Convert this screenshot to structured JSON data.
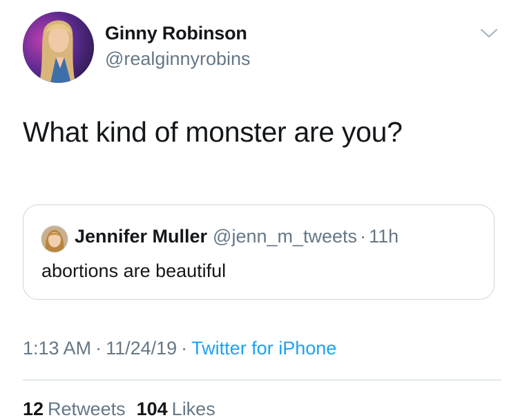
{
  "author": {
    "name": "Ginny Robinson",
    "handle": "@realginnyrobins"
  },
  "tweet": {
    "text": "What kind of monster are you?"
  },
  "quoted_tweet": {
    "name": "Jennifer Muller",
    "handle": "@jenn_m_tweets",
    "dot": "·",
    "time": "11h",
    "text": "abortions are beautiful"
  },
  "meta": {
    "time": "1:13 AM",
    "sep1": "·",
    "date": "11/24/19",
    "sep2": "·",
    "source": "Twitter for iPhone"
  },
  "stats": {
    "retweets_count": "12",
    "retweets_label": "Retweets",
    "likes_count": "104",
    "likes_label": "Likes"
  },
  "colors": {
    "link": "#1da1f2",
    "secondary_text": "#657786",
    "border": "#ccd6dd"
  },
  "icons": {
    "caret": "chevron-down-icon"
  }
}
